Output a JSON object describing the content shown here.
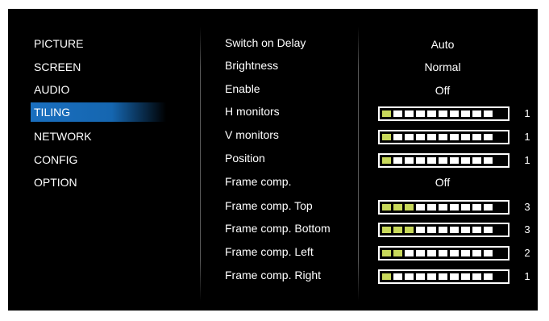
{
  "menu": {
    "items": [
      {
        "label": "PICTURE",
        "selected": false
      },
      {
        "label": "SCREEN",
        "selected": false
      },
      {
        "label": "AUDIO",
        "selected": false
      },
      {
        "label": "TILING",
        "selected": true
      },
      {
        "label": "NETWORK",
        "selected": false
      },
      {
        "label": "CONFIG",
        "selected": false
      },
      {
        "label": "OPTION",
        "selected": false
      }
    ]
  },
  "settings": [
    {
      "label": "Switch on Delay",
      "value": "Auto"
    },
    {
      "label": "Brightness",
      "value": "Normal"
    },
    {
      "label": "Enable",
      "value": "Off"
    },
    {
      "label": "H monitors",
      "value": "1",
      "slider_level": 1,
      "slider_segments": 10
    },
    {
      "label": "V monitors",
      "value": "1",
      "slider_level": 1,
      "slider_segments": 10
    },
    {
      "label": "Position",
      "value": "1",
      "slider_level": 1,
      "slider_segments": 10
    },
    {
      "label": "Frame comp.",
      "value": "Off"
    },
    {
      "label": "Frame comp. Top",
      "value": "3",
      "slider_level": 3,
      "slider_segments": 10
    },
    {
      "label": "Frame comp. Bottom",
      "value": "3",
      "slider_level": 3,
      "slider_segments": 10
    },
    {
      "label": "Frame comp. Left",
      "value": "2",
      "slider_level": 2,
      "slider_segments": 10
    },
    {
      "label": "Frame comp. Right",
      "value": "1",
      "slider_level": 1,
      "slider_segments": 10
    }
  ],
  "colors": {
    "background": "#000000",
    "text": "#ffffff",
    "selection": "#1566b0",
    "slider_active": "#c8d85a"
  }
}
